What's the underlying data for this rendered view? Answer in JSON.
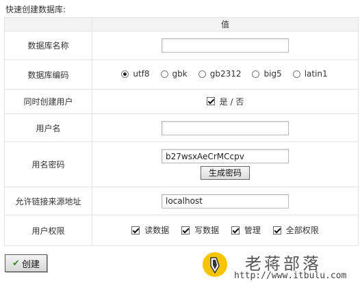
{
  "section_title": "快速创建数据库:",
  "table_header": {
    "col_label": "",
    "col_value": "值"
  },
  "fields": {
    "db_name": {
      "label": "数据库名称",
      "value": ""
    },
    "db_encoding": {
      "label": "数据库编码",
      "options": [
        "utf8",
        "gbk",
        "gb2312",
        "big5",
        "latin1"
      ],
      "selected": "utf8"
    },
    "create_user": {
      "label": "同时创建用户",
      "checked": true,
      "text": "是 / 否"
    },
    "username": {
      "label": "用户名",
      "value": ""
    },
    "password": {
      "label": "用名密码",
      "value": "b27wsxAeCrMCcpv",
      "generate_label": "生成密码"
    },
    "allowed_host": {
      "label": "允许链接来源地址",
      "value": "localhost"
    },
    "privileges": {
      "label": "用户权限",
      "items": [
        {
          "label": "读数据",
          "checked": true
        },
        {
          "label": "写数据",
          "checked": true
        },
        {
          "label": "管理",
          "checked": true
        },
        {
          "label": "全部权限",
          "checked": true
        }
      ]
    }
  },
  "create_button": "创建",
  "watermark": {
    "title": "老蒋部落",
    "url": "http://www.itbulu.com"
  },
  "colors": {
    "border": "#e3e3e3",
    "header_bg": "#f3f3f3",
    "watermark_yellow": "#f6c400"
  }
}
